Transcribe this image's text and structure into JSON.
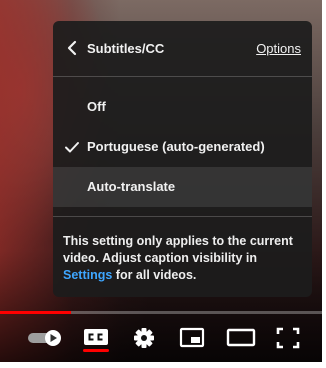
{
  "menu": {
    "title": "Subtitles/CC",
    "options_link": "Options",
    "items": [
      {
        "label": "Off",
        "selected": false
      },
      {
        "label": "Portuguese (auto-generated)",
        "selected": true
      },
      {
        "label": "Auto-translate",
        "selected": false,
        "hovered": true
      }
    ],
    "footnote": {
      "text_before": "This setting only applies to the current video. Adjust caption visibility in ",
      "link": "Settings",
      "text_after": " for all videos."
    }
  },
  "player": {
    "progress_fraction": 0.22,
    "captions_on": true,
    "controls": [
      "autoplay-toggle",
      "subtitles-cc-icon",
      "settings-gear-icon",
      "miniplayer-icon",
      "theater-mode-icon",
      "fullscreen-icon"
    ]
  },
  "colors": {
    "accent_red": "#ff0000",
    "link_blue": "#3ea6ff",
    "menu_bg": "#1c1c1c"
  }
}
